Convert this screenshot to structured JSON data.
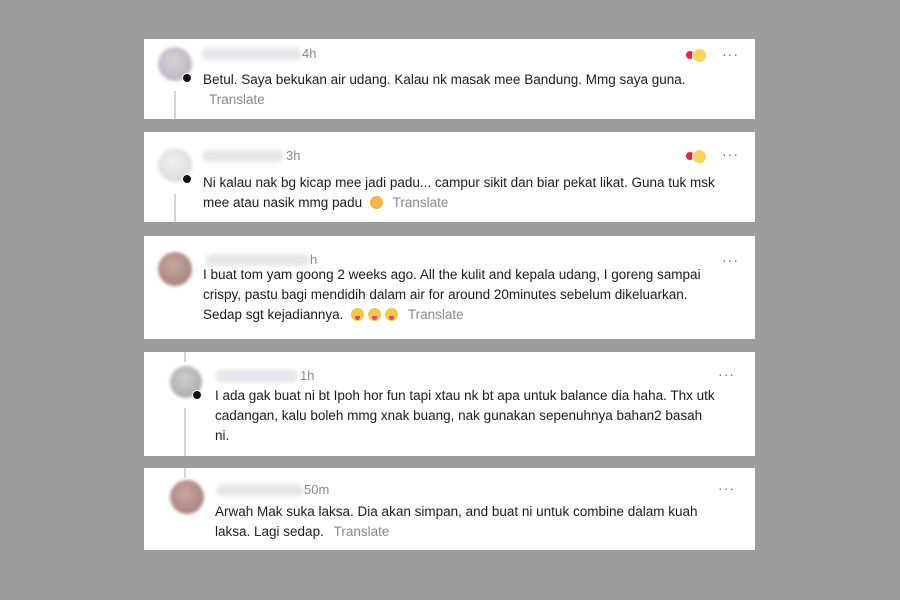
{
  "comments": [
    {
      "time": "4h",
      "text": "Betul. Saya bekukan air udang. Kalau nk masak mee Bandung. Mmg saya guna.",
      "translate": "Translate"
    },
    {
      "time": "3h",
      "text": "Ni kalau nak bg kicap mee jadi padu... campur sikit dan biar pekat likat. Guna tuk msk mee atau nasik mmg padu",
      "translate": "Translate"
    },
    {
      "time": "h",
      "text": "I buat tom yam goong 2 weeks ago. All the kulit and kepala udang, I goreng sampai crispy, pastu bagi mendidih dalam air for around 20minutes sebelum dikeluarkan. Sedap sgt kejadiannya.",
      "translate": "Translate"
    },
    {
      "time": "1h",
      "text": "I ada gak buat ni bt Ipoh hor fun tapi xtau nk bt apa untuk balance dia haha. Thx utk cadangan, kalu boleh mmg xnak buang, nak gunakan sepenuhnya bahan2 basah ni."
    },
    {
      "time": "50m",
      "text": "Arwah Mak suka laksa. Dia akan simpan, and buat ni untuk combine dalam kuah laksa. Lagi sedap.",
      "translate": "Translate"
    }
  ],
  "more_label": "···",
  "icons": {
    "more": "more-options-icon",
    "reaction": "reaction-icon",
    "emoji_hug": "hugging-face-emoji",
    "emoji_tongue": "tongue-face-emoji"
  },
  "colors": {
    "background": "#9c9c9c",
    "card": "#ffffff",
    "text": "#1c1c1c",
    "muted": "#8a8a8a",
    "heart": "#e2264d"
  }
}
